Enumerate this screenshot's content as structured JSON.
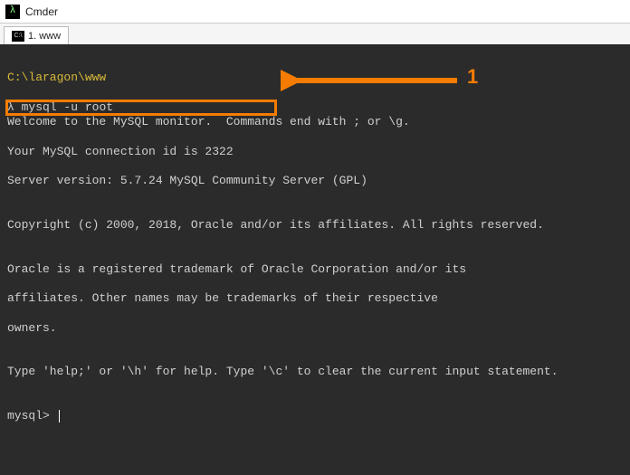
{
  "window": {
    "title": "Cmder",
    "icon_glyph": "λ"
  },
  "tab": {
    "label": "1. www",
    "icon_text": "C:\\"
  },
  "terminal": {
    "path": "C:\\laragon\\www",
    "prompt_symbol": "λ",
    "command": "mysql -u root",
    "output_lines": [
      "Welcome to the MySQL monitor.  Commands end with ; or \\g.",
      "Your MySQL connection id is 2322",
      "Server version: 5.7.24 MySQL Community Server (GPL)",
      "",
      "Copyright (c) 2000, 2018, Oracle and/or its affiliates. All rights reserved.",
      "",
      "Oracle is a registered trademark of Oracle Corporation and/or its",
      "affiliates. Other names may be trademarks of their respective",
      "owners.",
      "",
      "Type 'help;' or '\\h' for help. Type '\\c' to clear the current input statement.",
      ""
    ],
    "mysql_prompt": "mysql> "
  },
  "annotation": {
    "label": "1",
    "color": "#f57c00"
  }
}
